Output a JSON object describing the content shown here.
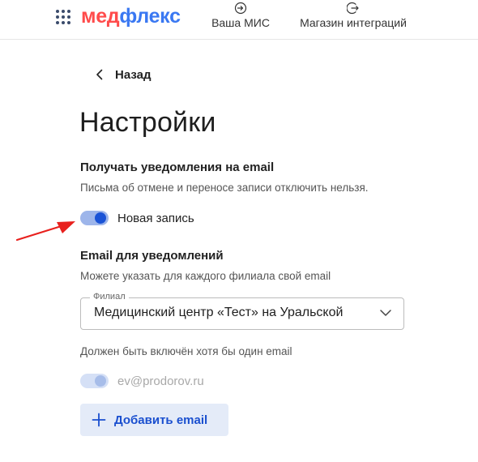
{
  "header": {
    "logo": {
      "part1": "мед",
      "part2": "флекс"
    },
    "nav": [
      {
        "label": "Ваша МИС",
        "icon": "login-icon"
      },
      {
        "label": "Магазин интеграций",
        "icon": "logout-icon"
      }
    ]
  },
  "back": {
    "label": "Назад",
    "icon": "chevron-left-icon"
  },
  "page": {
    "title": "Настройки"
  },
  "notifications": {
    "title": "Получать уведомления на email",
    "subtitle": "Письма об отмене и переносе записи отключить нельзя.",
    "toggle": {
      "label": "Новая запись",
      "checked": true
    }
  },
  "emails": {
    "title": "Email для уведомлений",
    "subtitle": "Можете указать для каждого филиала свой email",
    "branch_select": {
      "legend": "Филиал",
      "value": "Медицинский центр «Тест» на Уральской"
    },
    "hint": "Должен быть включён хотя бы один email",
    "email_toggle": {
      "label": "ev@prodorov.ru",
      "checked": true,
      "disabled": true
    },
    "add_button": {
      "label": "Добавить email",
      "icon": "plus-icon"
    }
  },
  "colors": {
    "logo_red": "#ff4b4b",
    "logo_blue": "#3a78f2",
    "accent": "#1a53d6",
    "annotation_arrow": "#e8201d"
  }
}
